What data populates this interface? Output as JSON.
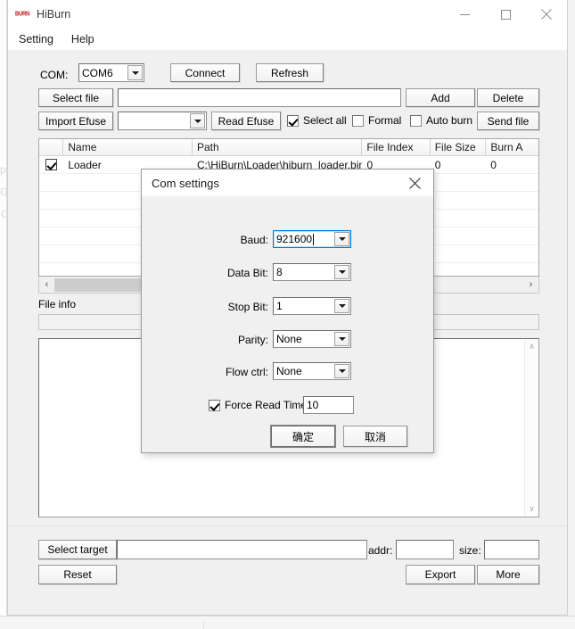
{
  "window": {
    "title": "HiBurn",
    "icon": "burn-logo-icon",
    "minimize": "—",
    "maximize": "□",
    "close": "✕"
  },
  "menu": {
    "items": [
      {
        "label": "Setting"
      },
      {
        "label": "Help"
      }
    ]
  },
  "toolbar": {
    "com_label": "COM:",
    "com_value": "COM6",
    "connect_label": "Connect",
    "refresh_label": "Refresh",
    "select_file_label": "Select file",
    "file_path_value": "",
    "add_label": "Add",
    "delete_label": "Delete",
    "import_efuse_label": "Import Efuse",
    "efuse_combo_value": "",
    "read_efuse_label": "Read Efuse",
    "select_all_label": "Select all",
    "select_all_checked": true,
    "formal_label": "Formal",
    "formal_checked": false,
    "auto_burn_label": "Auto burn",
    "auto_burn_checked": false,
    "send_file_label": "Send file"
  },
  "table": {
    "columns": [
      "",
      "Name",
      "Path",
      "File Index",
      "File Size",
      "Burn A"
    ],
    "rows": [
      {
        "checked": true,
        "name": "Loader",
        "path": "C:\\HiBurn\\Loader\\hiburn_loader.bin",
        "file_index": "0",
        "file_size": "0",
        "burn_addr": "0"
      }
    ],
    "scroll_left_arrow": "‹",
    "scroll_right_arrow": "›"
  },
  "file_info": {
    "label": "File info",
    "value": ""
  },
  "log": {
    "value": "",
    "scroll_up_arrow": "∧",
    "scroll_down_arrow": "∨"
  },
  "bottom": {
    "select_target_label": "Select target",
    "target_value": "",
    "addr_label": "addr:",
    "addr_value": "",
    "size_label": "size:",
    "size_value": "",
    "reset_label": "Reset",
    "export_label": "Export",
    "more_label": "More"
  },
  "dialog": {
    "title": "Com settings",
    "close": "✕",
    "fields": [
      {
        "label": "Baud:",
        "value": "921600",
        "focused": true
      },
      {
        "label": "Data Bit:",
        "value": "8",
        "focused": false
      },
      {
        "label": "Stop Bit:",
        "value": "1",
        "focused": false
      },
      {
        "label": "Parity:",
        "value": "None",
        "focused": false
      },
      {
        "label": "Flow ctrl:",
        "value": "None",
        "focused": false
      }
    ],
    "force_read_time_label": "Force Read Time",
    "force_read_time_checked": true,
    "force_read_time_value": "10",
    "ok_label": "确定",
    "cancel_label": "取消"
  },
  "colors": {
    "accent": "#0078d7",
    "logo_red": "#c7161d",
    "window_bg": "#f0f0f0"
  }
}
